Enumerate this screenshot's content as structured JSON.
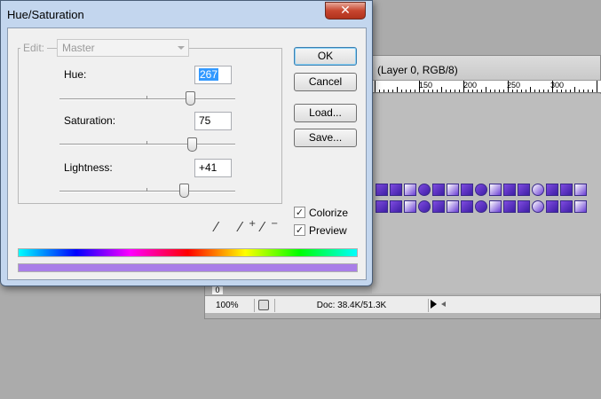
{
  "document_window": {
    "title": "(Layer 0, RGB/8)",
    "ruler_labels": [
      "150",
      "200",
      "250",
      "300"
    ],
    "zoom": "100%",
    "doc_size": "Doc: 38.4K/51.3K",
    "ruler_zero": "0"
  },
  "dialog": {
    "title": "Hue/Saturation",
    "close_glyph": "✕",
    "edit_label": "Edit:",
    "edit_value": "Master",
    "sliders": [
      {
        "label": "Hue:",
        "value": "267",
        "level": 0.74
      },
      {
        "label": "Saturation:",
        "value": "75",
        "level": 0.75
      },
      {
        "label": "Lightness:",
        "value": "+41",
        "level": 0.705
      }
    ],
    "buttons": {
      "ok": "OK",
      "cancel": "Cancel",
      "load": "Load...",
      "save": "Save..."
    },
    "checkboxes": [
      {
        "label": "Colorize",
        "checked": true
      },
      {
        "label": "Preview",
        "checked": true
      }
    ],
    "check_glyph": "✓",
    "eyedropper_icons": [
      "eyedropper-icon",
      "eyedropper-plus-icon",
      "eyedropper-minus-icon"
    ],
    "colors": {
      "adjusted_bar": "#a97ee8",
      "selection": "#3399ff",
      "titlebar": "#c3d6ee"
    }
  }
}
